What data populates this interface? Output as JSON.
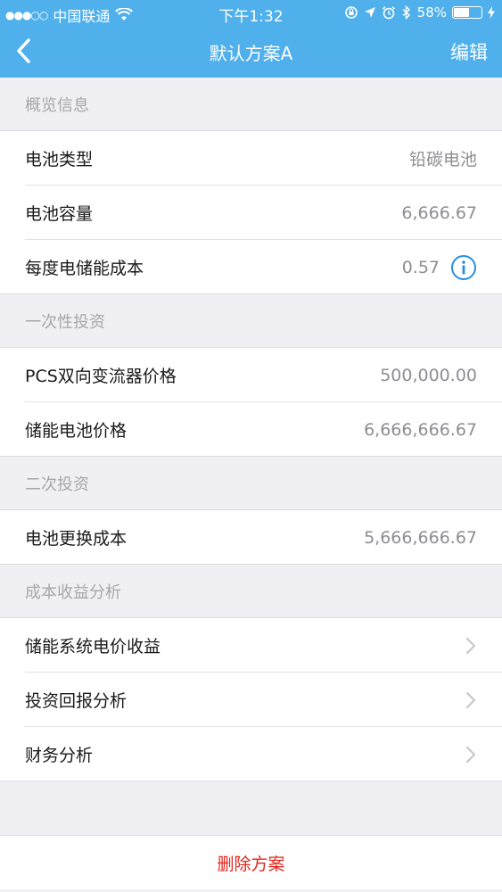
{
  "status_bar": {
    "signal_dots": "●●●○○",
    "carrier": "中国联通",
    "time": "下午1:32",
    "battery_percent": "58%",
    "battery_level": 0.58
  },
  "nav": {
    "title": "默认方案A",
    "edit_label": "编辑",
    "back_icon": "chevron-left-icon"
  },
  "sections": {
    "overview": {
      "header": "概览信息",
      "battery_type_label": "电池类型",
      "battery_type_value": "铅碳电池",
      "battery_capacity_label": "电池容量",
      "battery_capacity_value": "6,666.67",
      "storage_cost_label": "每度电储能成本",
      "storage_cost_value": "0.57"
    },
    "one_time": {
      "header": "一次性投资",
      "pcs_label": "PCS双向变流器价格",
      "pcs_value": "500,000.00",
      "battery_price_label": "储能电池价格",
      "battery_price_value": "6,666,666.67"
    },
    "secondary": {
      "header": "二次投资",
      "replace_cost_label": "电池更换成本",
      "replace_cost_value": "5,666,666.67"
    },
    "analysis": {
      "header": "成本收益分析",
      "items": [
        {
          "label": "储能系统电价收益"
        },
        {
          "label": "投资回报分析"
        },
        {
          "label": "财务分析"
        }
      ]
    }
  },
  "actions": {
    "delete_label": "删除方案"
  },
  "colors": {
    "nav_blue": "#4fb0ec",
    "delete_red": "#e2231a",
    "info_blue": "#2a8ee0"
  }
}
